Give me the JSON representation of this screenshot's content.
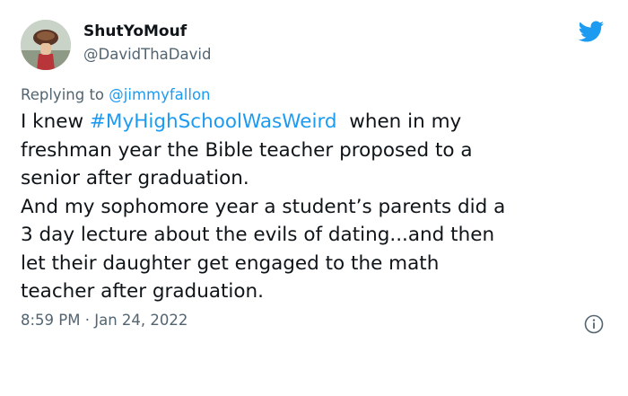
{
  "user": {
    "name": "ShutYoMouf",
    "handle": "@DavidThaDavid"
  },
  "reply": {
    "prefix": "Replying to ",
    "mention": "@jimmyfallon"
  },
  "tweet": {
    "l1_a": "I knew ",
    "hashtag": "#MyHighSchoolWasWeird",
    "l1_b": "  when in my",
    "l2": "freshman year the Bible teacher proposed to a",
    "l3": "senior after graduation.",
    "l4": "And my sophomore year a student’s parents did a",
    "l5": "3 day lecture about the evils of dating...and then",
    "l6": "let their daughter get engaged to the math",
    "l7": "teacher after graduation."
  },
  "meta": {
    "timestamp": "8:59 PM · Jan 24, 2022"
  },
  "icons": {
    "brand": "twitter-bird-icon",
    "info": "info-icon"
  },
  "colors": {
    "accent": "#1d9bf0",
    "secondary_text": "#536471",
    "primary_text": "#0f1419"
  }
}
